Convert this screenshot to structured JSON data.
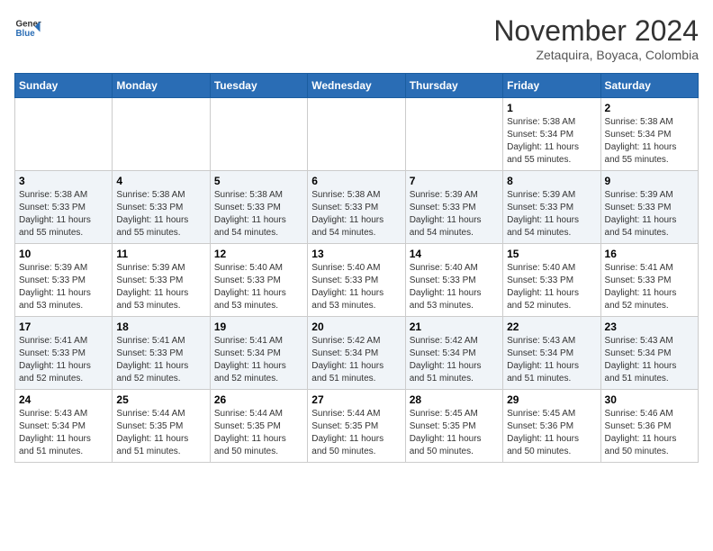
{
  "header": {
    "logo_line1": "General",
    "logo_line2": "Blue",
    "month": "November 2024",
    "location": "Zetaquira, Boyaca, Colombia"
  },
  "weekdays": [
    "Sunday",
    "Monday",
    "Tuesday",
    "Wednesday",
    "Thursday",
    "Friday",
    "Saturday"
  ],
  "weeks": [
    [
      {
        "day": "",
        "info": ""
      },
      {
        "day": "",
        "info": ""
      },
      {
        "day": "",
        "info": ""
      },
      {
        "day": "",
        "info": ""
      },
      {
        "day": "",
        "info": ""
      },
      {
        "day": "1",
        "info": "Sunrise: 5:38 AM\nSunset: 5:34 PM\nDaylight: 11 hours\nand 55 minutes."
      },
      {
        "day": "2",
        "info": "Sunrise: 5:38 AM\nSunset: 5:34 PM\nDaylight: 11 hours\nand 55 minutes."
      }
    ],
    [
      {
        "day": "3",
        "info": "Sunrise: 5:38 AM\nSunset: 5:33 PM\nDaylight: 11 hours\nand 55 minutes."
      },
      {
        "day": "4",
        "info": "Sunrise: 5:38 AM\nSunset: 5:33 PM\nDaylight: 11 hours\nand 55 minutes."
      },
      {
        "day": "5",
        "info": "Sunrise: 5:38 AM\nSunset: 5:33 PM\nDaylight: 11 hours\nand 54 minutes."
      },
      {
        "day": "6",
        "info": "Sunrise: 5:38 AM\nSunset: 5:33 PM\nDaylight: 11 hours\nand 54 minutes."
      },
      {
        "day": "7",
        "info": "Sunrise: 5:39 AM\nSunset: 5:33 PM\nDaylight: 11 hours\nand 54 minutes."
      },
      {
        "day": "8",
        "info": "Sunrise: 5:39 AM\nSunset: 5:33 PM\nDaylight: 11 hours\nand 54 minutes."
      },
      {
        "day": "9",
        "info": "Sunrise: 5:39 AM\nSunset: 5:33 PM\nDaylight: 11 hours\nand 54 minutes."
      }
    ],
    [
      {
        "day": "10",
        "info": "Sunrise: 5:39 AM\nSunset: 5:33 PM\nDaylight: 11 hours\nand 53 minutes."
      },
      {
        "day": "11",
        "info": "Sunrise: 5:39 AM\nSunset: 5:33 PM\nDaylight: 11 hours\nand 53 minutes."
      },
      {
        "day": "12",
        "info": "Sunrise: 5:40 AM\nSunset: 5:33 PM\nDaylight: 11 hours\nand 53 minutes."
      },
      {
        "day": "13",
        "info": "Sunrise: 5:40 AM\nSunset: 5:33 PM\nDaylight: 11 hours\nand 53 minutes."
      },
      {
        "day": "14",
        "info": "Sunrise: 5:40 AM\nSunset: 5:33 PM\nDaylight: 11 hours\nand 53 minutes."
      },
      {
        "day": "15",
        "info": "Sunrise: 5:40 AM\nSunset: 5:33 PM\nDaylight: 11 hours\nand 52 minutes."
      },
      {
        "day": "16",
        "info": "Sunrise: 5:41 AM\nSunset: 5:33 PM\nDaylight: 11 hours\nand 52 minutes."
      }
    ],
    [
      {
        "day": "17",
        "info": "Sunrise: 5:41 AM\nSunset: 5:33 PM\nDaylight: 11 hours\nand 52 minutes."
      },
      {
        "day": "18",
        "info": "Sunrise: 5:41 AM\nSunset: 5:33 PM\nDaylight: 11 hours\nand 52 minutes."
      },
      {
        "day": "19",
        "info": "Sunrise: 5:41 AM\nSunset: 5:34 PM\nDaylight: 11 hours\nand 52 minutes."
      },
      {
        "day": "20",
        "info": "Sunrise: 5:42 AM\nSunset: 5:34 PM\nDaylight: 11 hours\nand 51 minutes."
      },
      {
        "day": "21",
        "info": "Sunrise: 5:42 AM\nSunset: 5:34 PM\nDaylight: 11 hours\nand 51 minutes."
      },
      {
        "day": "22",
        "info": "Sunrise: 5:43 AM\nSunset: 5:34 PM\nDaylight: 11 hours\nand 51 minutes."
      },
      {
        "day": "23",
        "info": "Sunrise: 5:43 AM\nSunset: 5:34 PM\nDaylight: 11 hours\nand 51 minutes."
      }
    ],
    [
      {
        "day": "24",
        "info": "Sunrise: 5:43 AM\nSunset: 5:34 PM\nDaylight: 11 hours\nand 51 minutes."
      },
      {
        "day": "25",
        "info": "Sunrise: 5:44 AM\nSunset: 5:35 PM\nDaylight: 11 hours\nand 51 minutes."
      },
      {
        "day": "26",
        "info": "Sunrise: 5:44 AM\nSunset: 5:35 PM\nDaylight: 11 hours\nand 50 minutes."
      },
      {
        "day": "27",
        "info": "Sunrise: 5:44 AM\nSunset: 5:35 PM\nDaylight: 11 hours\nand 50 minutes."
      },
      {
        "day": "28",
        "info": "Sunrise: 5:45 AM\nSunset: 5:35 PM\nDaylight: 11 hours\nand 50 minutes."
      },
      {
        "day": "29",
        "info": "Sunrise: 5:45 AM\nSunset: 5:36 PM\nDaylight: 11 hours\nand 50 minutes."
      },
      {
        "day": "30",
        "info": "Sunrise: 5:46 AM\nSunset: 5:36 PM\nDaylight: 11 hours\nand 50 minutes."
      }
    ]
  ]
}
